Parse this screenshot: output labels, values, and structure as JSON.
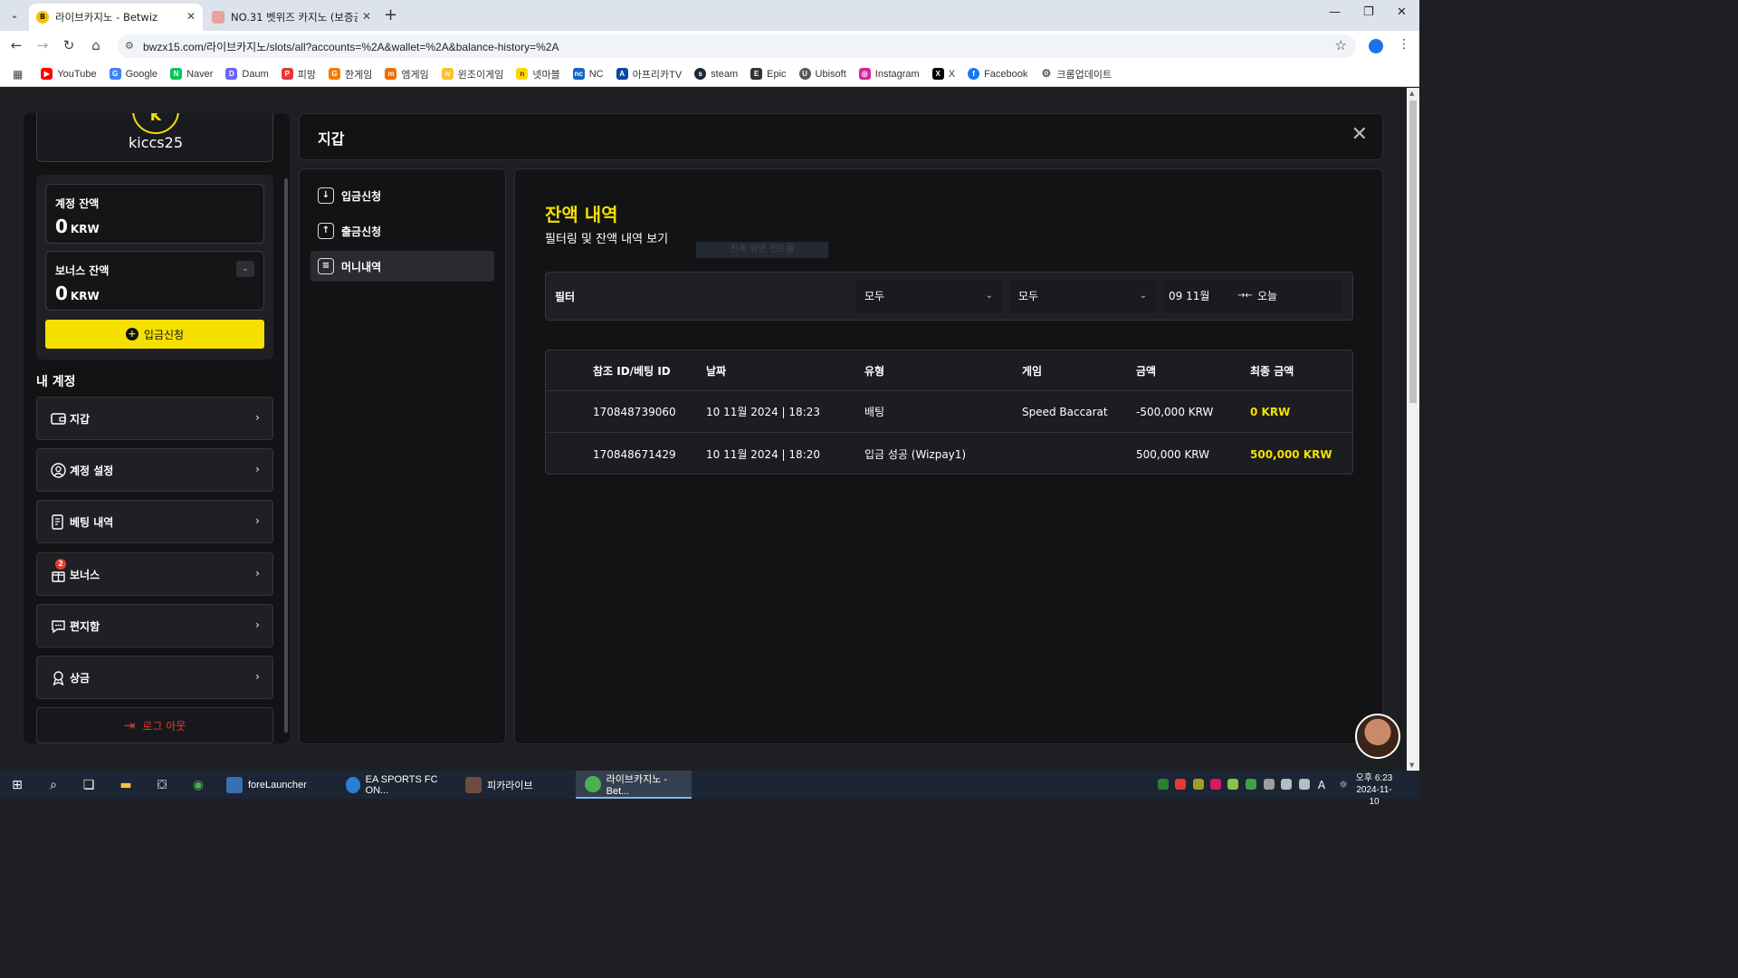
{
  "browser": {
    "tabs": [
      {
        "title": "라이브카지노 - Betwiz",
        "active": true
      },
      {
        "title": "NO.31 벳위즈 카지노 (보증금",
        "active": false
      }
    ],
    "url": "bwzx15.com/라이브카지노/slots/all?accounts=%2A&wallet=%2A&balance-history=%2A",
    "bookmarks": [
      "YouTube",
      "Google",
      "Naver",
      "Daum",
      "피망",
      "한게임",
      "엠게임",
      "윈조이게임",
      "넷마블",
      "NC",
      "아프리카TV",
      "steam",
      "Epic",
      "Ubisoft",
      "Instagram",
      "X",
      "Facebook",
      "크롬업데이트"
    ]
  },
  "sidebar": {
    "avatar_initials": "K",
    "username": "kiccs25",
    "account_balance": {
      "label": "계정 잔액",
      "amount": "0",
      "currency": "KRW"
    },
    "bonus_balance": {
      "label": "보너스 잔액",
      "amount": "0",
      "currency": "KRW"
    },
    "deposit_button": "입금신청",
    "section_title": "내 계정",
    "menu": [
      {
        "label": "지갑",
        "icon": "wallet-icon"
      },
      {
        "label": "계정 설정",
        "icon": "user-icon"
      },
      {
        "label": "베팅 내역",
        "icon": "receipt-icon"
      },
      {
        "label": "보너스",
        "icon": "gift-icon",
        "badge": "2"
      },
      {
        "label": "편지함",
        "icon": "chat-icon"
      },
      {
        "label": "상금",
        "icon": "award-icon"
      }
    ],
    "logout": "로그 아웃"
  },
  "wallet": {
    "title": "지갑",
    "nav": [
      {
        "label": "입금신청",
        "icon": "download-icon"
      },
      {
        "label": "출금신청",
        "icon": "upload-icon"
      },
      {
        "label": "머니내역",
        "icon": "document-icon",
        "active": true
      }
    ],
    "heading": "잔액 내역",
    "subheading": "필터링 및 잔액 내역 보기",
    "ghost_text": "전체 화면 컨트롤",
    "filter": {
      "label": "필터",
      "select1": "모두",
      "select2": "모두",
      "date_from": "09 11월",
      "date_to": "오늘"
    },
    "table": {
      "headers": [
        "참조 ID/베팅 ID",
        "날짜",
        "유형",
        "게임",
        "금액",
        "최종 금액"
      ],
      "rows": [
        [
          "170848739060",
          "10 11월 2024 | 18:23",
          "배팅",
          "Speed Baccarat I",
          "-500,000 KRW",
          "0 KRW"
        ],
        [
          "170848671429",
          "10 11월 2024 | 18:20",
          "입금 성공 (Wizpay1)",
          "",
          "500,000 KRW",
          "500,000 KRW"
        ]
      ]
    }
  },
  "taskbar": {
    "apps": [
      "foreLauncher",
      "EA SPORTS FC ON...",
      "피카라이브",
      "라이브카지노 - Bet..."
    ],
    "time": "오후 6:23",
    "date": "2024-11-10"
  },
  "colors": {
    "accent": "#f5e000",
    "logout": "#e53935",
    "panel": "#131316"
  }
}
